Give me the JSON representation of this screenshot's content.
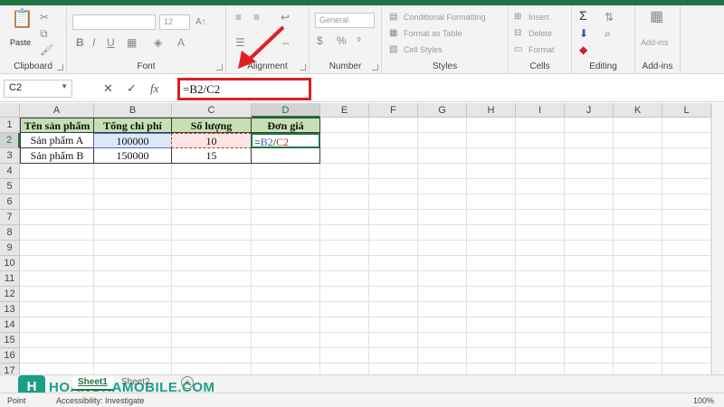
{
  "ribbon": {
    "clipboard": {
      "paste_label": "Paste",
      "group_label": "Clipboard"
    },
    "font": {
      "size_value": "12",
      "group_label": "Font"
    },
    "alignment": {
      "group_label": "Alignment"
    },
    "number": {
      "format_value": "General",
      "group_label": "Number"
    },
    "styles": {
      "conditional": "Conditional Formatting",
      "table": "Format as Table",
      "cell_styles": "Cell Styles",
      "group_label": "Styles"
    },
    "cells": {
      "insert": "Insert",
      "delete": "Delete",
      "format": "Format",
      "group_label": "Cells"
    },
    "editing": {
      "group_label": "Editing"
    },
    "addins": {
      "button": "Add-ins",
      "group_label": "Add-ins"
    }
  },
  "formula_bar": {
    "name_box": "C2",
    "cancel": "✕",
    "enter": "✓",
    "fx": "fx",
    "formula": "=B2/C2"
  },
  "grid": {
    "columns": [
      "A",
      "B",
      "C",
      "D",
      "E",
      "F",
      "G",
      "H",
      "I",
      "J",
      "K",
      "L"
    ],
    "rows": [
      "1",
      "2",
      "3",
      "4",
      "5",
      "6",
      "7",
      "8",
      "9",
      "10",
      "11",
      "12",
      "13",
      "14",
      "15",
      "16",
      "17"
    ],
    "selected_column": "D",
    "selected_row": "2",
    "cells": {
      "A1": "Tên sản phẩm",
      "B1": "Tổng chi phí",
      "C1": "Số lượng",
      "D1": "Đơn giá",
      "A2": "Sản phẩm A",
      "B2": "100000",
      "C2": "10",
      "D2_prefix": "=",
      "D2_ref1": "B2",
      "D2_slash": "/",
      "D2_ref2": "C2",
      "A3": "Sản phẩm B",
      "B3": "150000",
      "C3": "15"
    }
  },
  "sheets": {
    "active": "Sheet1",
    "other": "Sheet2",
    "add": "+"
  },
  "status": {
    "mode": "Point",
    "accessibility": "Accessibility: Investigate",
    "zoom": "100%"
  },
  "watermark": {
    "mark": "H",
    "text": "HOANGHAMOBILE.COM"
  },
  "colors": {
    "accent": "#217346",
    "header_fill": "#c6e0b4",
    "highlight": "#d82020",
    "ref_b": "#4472c4",
    "ref_c": "#c0282d"
  }
}
